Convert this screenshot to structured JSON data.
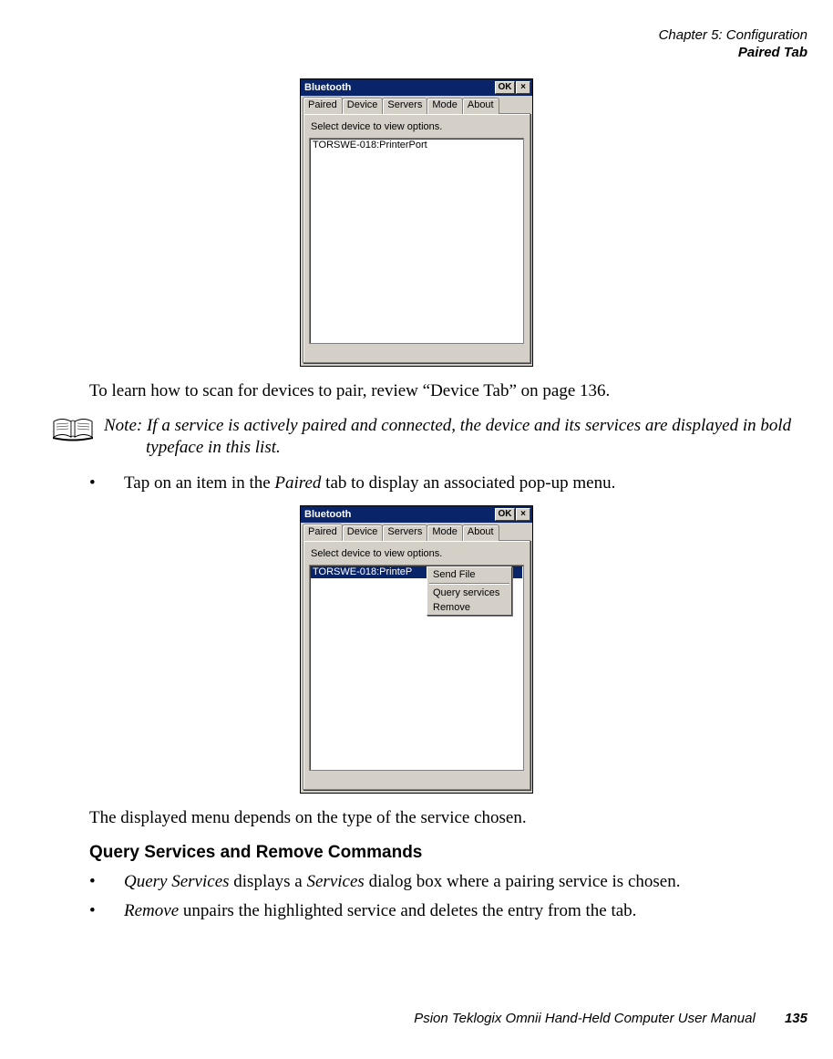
{
  "header": {
    "chapter": "Chapter 5: Configuration",
    "section": "Paired Tab"
  },
  "screenshot1": {
    "title": "Bluetooth",
    "ok_label": "OK",
    "close_label": "×",
    "tabs": [
      "Paired",
      "Device",
      "Servers",
      "Mode",
      "About"
    ],
    "active_tab_index": 0,
    "instruction": "Select device to view options.",
    "list_items": [
      "TORSWE-018:PrinterPort"
    ]
  },
  "para1": "To learn how to scan for devices to pair, review “Device Tab” on page 136.",
  "note": {
    "label": "Note:",
    "text": "If a service is actively paired and connected, the device and its services are displayed in bold typeface in this list."
  },
  "bullet1_pre": "Tap on an item in the ",
  "bullet1_em": "Paired",
  "bullet1_post": " tab to display an associated pop-up menu.",
  "screenshot2": {
    "title": "Bluetooth",
    "ok_label": "OK",
    "close_label": "×",
    "tabs": [
      "Paired",
      "Device",
      "Servers",
      "Mode",
      "About"
    ],
    "active_tab_index": 0,
    "instruction": "Select device to view options.",
    "list_items": [
      "TORSWE-018:PrinteP"
    ],
    "selected_index": 0,
    "popup": {
      "items": [
        "Send File",
        "Query services",
        "Remove"
      ],
      "separator_after_index": 0
    }
  },
  "para2": "The displayed menu depends on the type of the service chosen.",
  "subhead": "Query Services and Remove Commands",
  "qsr": {
    "b1_em1": "Query Services",
    "b1_mid": " displays a ",
    "b1_em2": "Services",
    "b1_post": " dialog box where a pairing service is chosen.",
    "b2_em": "Remove",
    "b2_post": " unpairs the highlighted service and deletes the entry from the tab."
  },
  "footer": {
    "text": "Psion Teklogix Omnii Hand-Held Computer User Manual",
    "page": "135"
  }
}
